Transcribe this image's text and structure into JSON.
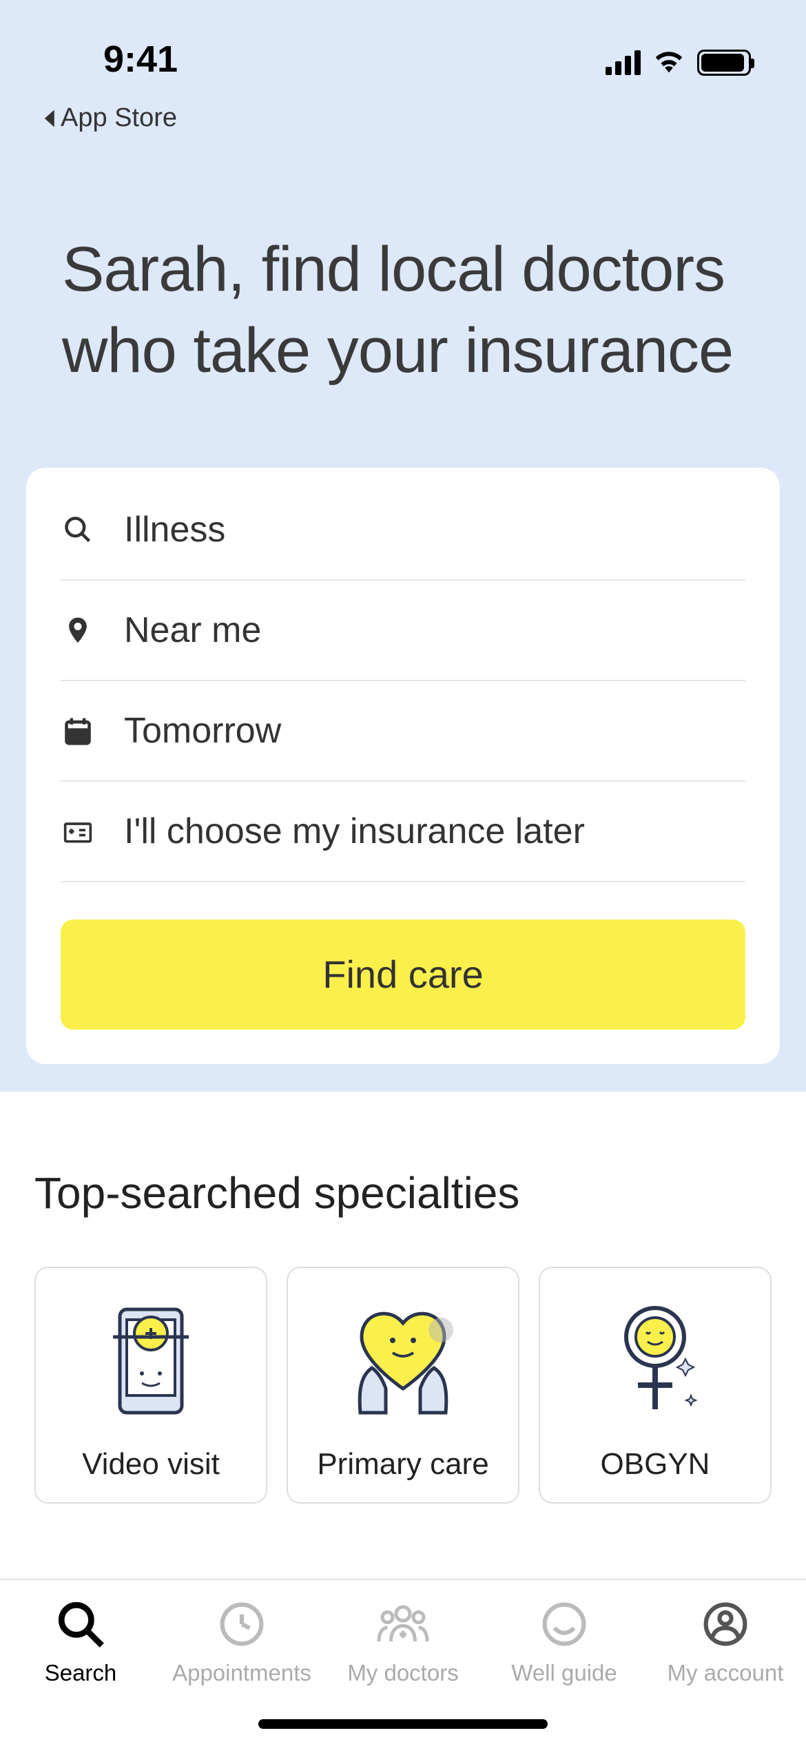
{
  "status": {
    "time": "9:41"
  },
  "back_link": "App Store",
  "headline": "Sarah, find local doctors who take your insurance",
  "search": {
    "condition": "Illness",
    "location": "Near me",
    "date": "Tomorrow",
    "insurance": "I'll choose my insurance later",
    "button": "Find care"
  },
  "specialties": {
    "title": "Top-searched specialties",
    "cards": [
      {
        "label": "Video visit"
      },
      {
        "label": "Primary care"
      },
      {
        "label": "OBGYN"
      }
    ]
  },
  "tabs": [
    {
      "label": "Search"
    },
    {
      "label": "Appointments"
    },
    {
      "label": "My doctors"
    },
    {
      "label": "Well guide"
    },
    {
      "label": "My account"
    }
  ]
}
